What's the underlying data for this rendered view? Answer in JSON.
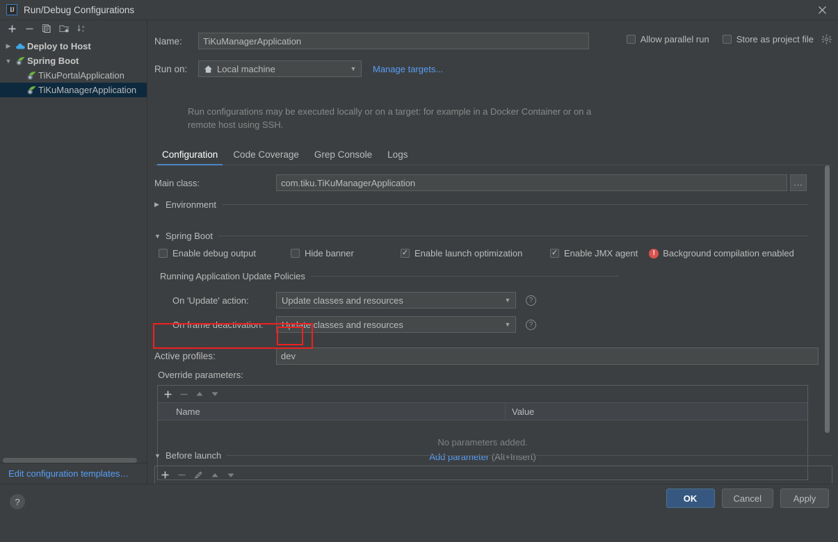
{
  "window": {
    "title": "Run/Debug Configurations",
    "app_icon": "IJ",
    "close_icon": "close-icon"
  },
  "sidebar": {
    "toolbar": [
      {
        "name": "add-configuration-button",
        "icon": "plus-icon",
        "glyph": "+"
      },
      {
        "name": "remove-configuration-button",
        "icon": "minus-icon",
        "glyph": "−"
      },
      {
        "name": "copy-configuration-button",
        "icon": "copy-icon",
        "glyph": "copy"
      },
      {
        "name": "new-folder-button",
        "icon": "folder-add-icon",
        "glyph": "folder"
      },
      {
        "name": "sort-configurations-button",
        "icon": "sort-alpha-icon",
        "glyph": "sort"
      }
    ],
    "tree": [
      {
        "label": "Deploy to Host",
        "icon": "cloud-icon",
        "expanded": false,
        "twisty": "▶",
        "bold": true,
        "child": false,
        "selected": false
      },
      {
        "label": "Spring Boot",
        "icon": "spring-leaf-icon",
        "expanded": true,
        "twisty": "▼",
        "bold": true,
        "child": false,
        "selected": false
      },
      {
        "label": "TiKuPortalApplication",
        "icon": "spring-leaf-icon",
        "twisty": "",
        "bold": false,
        "child": true,
        "selected": false
      },
      {
        "label": "TiKuManagerApplication",
        "icon": "spring-leaf-icon",
        "twisty": "",
        "bold": false,
        "child": true,
        "selected": true
      }
    ],
    "edit_templates_link": "Edit configuration templates…"
  },
  "form": {
    "name_label": "Name:",
    "name_value": "TiKuManagerApplication",
    "allow_parallel_run": {
      "label": "Allow parallel run",
      "checked": false
    },
    "store_as_project_file": {
      "label": "Store as project file",
      "checked": false,
      "gear_icon": "gear-icon"
    },
    "run_on_label": "Run on:",
    "run_on_value": "Local machine",
    "run_on_icon": "home-icon",
    "manage_targets_link": "Manage targets...",
    "description": "Run configurations may be executed locally or on a target: for example in a Docker Container or on a remote host using SSH."
  },
  "tabs": [
    {
      "label": "Configuration",
      "active": true
    },
    {
      "label": "Code Coverage",
      "active": false
    },
    {
      "label": "Grep Console",
      "active": false
    },
    {
      "label": "Logs",
      "active": false
    }
  ],
  "configuration": {
    "main_class_label": "Main class:",
    "main_class_value": "com.tiku.TiKuManagerApplication",
    "browse_button": "...",
    "environment_section": {
      "title": "Environment",
      "expanded": false,
      "twisty": "▶"
    },
    "spring_boot_section": {
      "title": "Spring Boot",
      "expanded": true,
      "twisty": "▼"
    },
    "spring_checks": [
      {
        "label": "Enable debug output",
        "checked": false
      },
      {
        "label": "Hide banner",
        "checked": false
      },
      {
        "label": "Enable launch optimization",
        "checked": true
      },
      {
        "label": "Enable JMX agent",
        "checked": true
      }
    ],
    "background_compilation": {
      "label": "Background compilation enabled",
      "icon": "error-icon",
      "icon_glyph": "!",
      "color": "#d9534f"
    },
    "update_policies_title": "Running Application Update Policies",
    "policies": [
      {
        "label": "On 'Update' action:",
        "value": "Update classes and resources",
        "help_icon": "help-icon"
      },
      {
        "label": "On frame deactivation:",
        "value": "Update classes and resources",
        "help_icon": "help-icon"
      }
    ],
    "active_profiles_label": "Active profiles:",
    "active_profiles_value": "dev",
    "override_parameters_label": "Override parameters:",
    "parameters_table": {
      "toolbar": [
        {
          "name": "add-parameter-button",
          "icon": "plus-icon",
          "glyph": "+",
          "enabled": true
        },
        {
          "name": "remove-parameter-button",
          "icon": "minus-icon",
          "glyph": "−",
          "enabled": false
        },
        {
          "name": "move-up-button",
          "icon": "arrow-up-icon",
          "glyph": "▲",
          "enabled": false
        },
        {
          "name": "move-down-button",
          "icon": "arrow-down-icon",
          "glyph": "▼",
          "enabled": false
        }
      ],
      "columns": [
        "Name",
        "Value"
      ],
      "rows": [],
      "empty_text": "No parameters added.",
      "add_link": "Add parameter",
      "add_shortcut": "(Alt+Insert)"
    },
    "before_launch_section": {
      "title": "Before launch",
      "expanded": true,
      "twisty": "▼"
    },
    "before_launch_toolbar": [
      {
        "name": "bl-add-button",
        "icon": "plus-icon",
        "glyph": "+",
        "enabled": true
      },
      {
        "name": "bl-remove-button",
        "icon": "minus-icon",
        "glyph": "−",
        "enabled": false
      },
      {
        "name": "bl-edit-button",
        "icon": "pencil-icon",
        "glyph": "✎",
        "enabled": false
      },
      {
        "name": "bl-move-up-button",
        "icon": "arrow-up-icon",
        "glyph": "▲",
        "enabled": false
      },
      {
        "name": "bl-move-down-button",
        "icon": "arrow-down-icon",
        "glyph": "▼",
        "enabled": false
      }
    ]
  },
  "footer": {
    "help_button": "?",
    "ok_label": "OK",
    "cancel_label": "Cancel",
    "apply_label": "Apply"
  },
  "annotations": {
    "highlight_color": "#f02020",
    "boxes": [
      "active-profiles-row",
      "active-profiles-value"
    ]
  }
}
